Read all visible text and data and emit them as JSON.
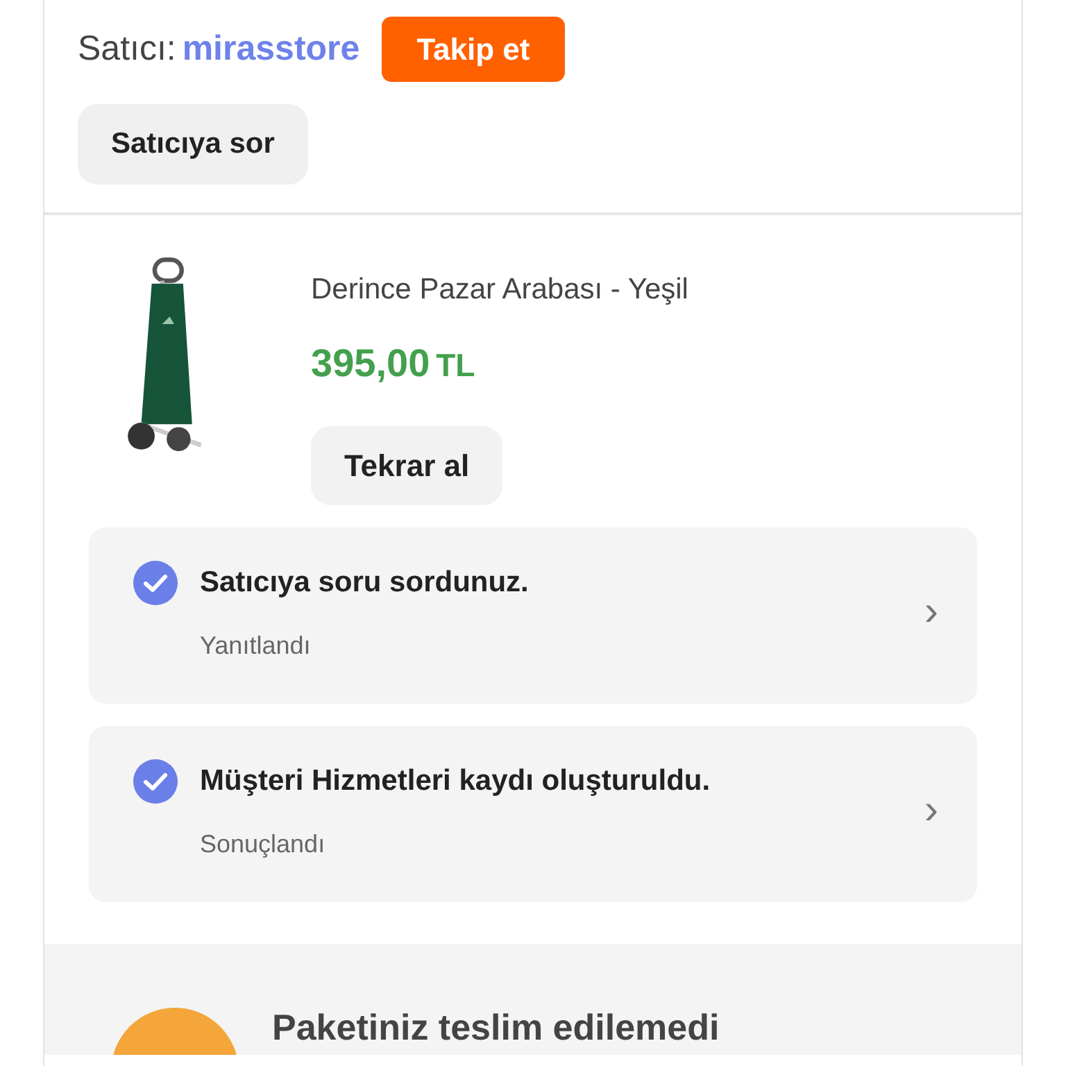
{
  "seller": {
    "label": "Satıcı:",
    "name": "mirasstore",
    "follow_button": "Takip et",
    "ask_button": "Satıcıya sor"
  },
  "product": {
    "kind": "picture",
    "title": "Derince Pazar Arabası - Yeşil",
    "price": "395,00",
    "currency": "TL",
    "rebuy_button": "Tekrar al"
  },
  "events": [
    {
      "title": "Satıcıya soru sordunuz.",
      "status": "Yanıtlandı",
      "chevron": "›"
    },
    {
      "title": "Müşteri Hizmetleri kaydı oluşturuldu.",
      "status": "Sonuçlandı",
      "chevron": "›"
    }
  ],
  "delivery": {
    "title": "Paketiniz teslim edilemedi"
  }
}
